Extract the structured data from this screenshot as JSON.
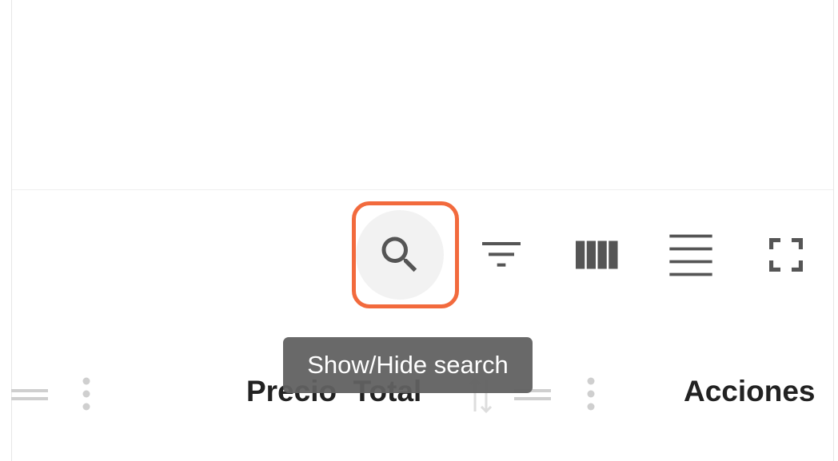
{
  "toolbar": {
    "search_tooltip": "Show/Hide search",
    "icons": [
      "search-icon",
      "filter-icon",
      "columns-icon",
      "density-icon",
      "fullscreen-icon"
    ]
  },
  "table": {
    "columns": [
      {
        "label": "Precio  Total"
      },
      {
        "label": "Acciones"
      }
    ]
  },
  "colors": {
    "highlight": "#f26a3d",
    "tooltip_bg": "#616161",
    "icon": "#555555"
  }
}
